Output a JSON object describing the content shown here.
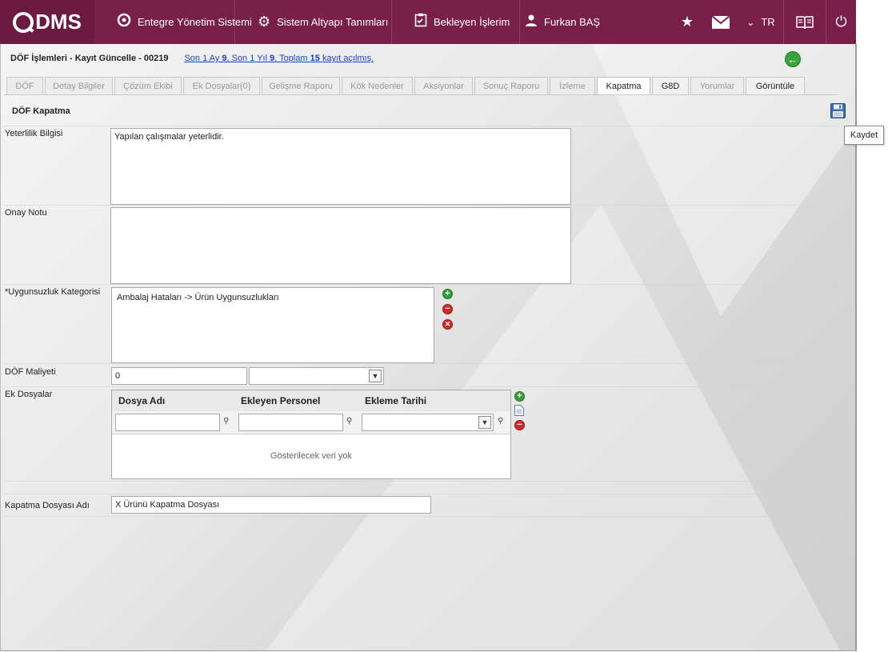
{
  "topbar": {
    "logo": "DMS",
    "nav": [
      {
        "label": "Entegre Yönetim Sistemi",
        "icon": "q-logo-icon"
      },
      {
        "label": "Sistem Altyapı Tanımları",
        "icon": "gear-icon"
      },
      {
        "label": "Bekleyen İşlerim",
        "icon": "clipboard-icon"
      },
      {
        "label": "Furkan BAŞ",
        "icon": "user-icon"
      }
    ],
    "lang": "TR",
    "accent": "#7a1f4a"
  },
  "header": {
    "title": "DÖF İşlemleri - Kayıt Güncelle - 00219",
    "info_prefix": "Son 1 Ay ",
    "month_count": "9",
    "info_mid": ", Son 1 Yıl ",
    "year_count": "9",
    "info_mid2": ", Toplam ",
    "total_count": "15",
    "info_suffix": " kayıt açılmış."
  },
  "tabs": [
    {
      "label": "DÖF",
      "state": "disabled"
    },
    {
      "label": "Detay Bilgiler",
      "state": "disabled"
    },
    {
      "label": "Çözüm Ekibi",
      "state": "disabled"
    },
    {
      "label": "Ek Dosyalar(0)",
      "state": "disabled"
    },
    {
      "label": "Gelişme Raporu",
      "state": "disabled"
    },
    {
      "label": "Kök Nedenler",
      "state": "disabled"
    },
    {
      "label": "Aksiyonlar",
      "state": "disabled"
    },
    {
      "label": "Sonuç Raporu",
      "state": "disabled"
    },
    {
      "label": "İzleme",
      "state": "disabled"
    },
    {
      "label": "Kapatma",
      "state": "active"
    },
    {
      "label": "G8D",
      "state": "enabled"
    },
    {
      "label": "Yorumlar",
      "state": "disabled"
    },
    {
      "label": "Görüntüle",
      "state": "enabled"
    }
  ],
  "form": {
    "section_title": "DÖF Kapatma",
    "save_tooltip": "Kaydet",
    "yeterlilik_label": "Yeterlilik Bilgisi",
    "yeterlilik_value": "Yapılan çalışmalar yeterlidir.",
    "onay_label": "Onay Notu",
    "onay_value": "",
    "kategori_label": "*Uygunsuzluk Kategorisi",
    "kategori_value": "Ambalaj Hataları -> Ürün Uygunsuzlukları",
    "maliyet_label": "DÖF Maliyeti",
    "maliyet_value": "0",
    "maliyet_currency": "",
    "ek_label": "Ek Dosyalar",
    "grid_columns": [
      "Dosya Adı",
      "Ekleyen Personel",
      "Ekleme Tarihi"
    ],
    "grid_empty": "Gösterilecek veri yok",
    "kapatma_label": "Kapatma Dosyası Adı",
    "kapatma_value": "X Ürünü Kapatma Dosyası"
  }
}
